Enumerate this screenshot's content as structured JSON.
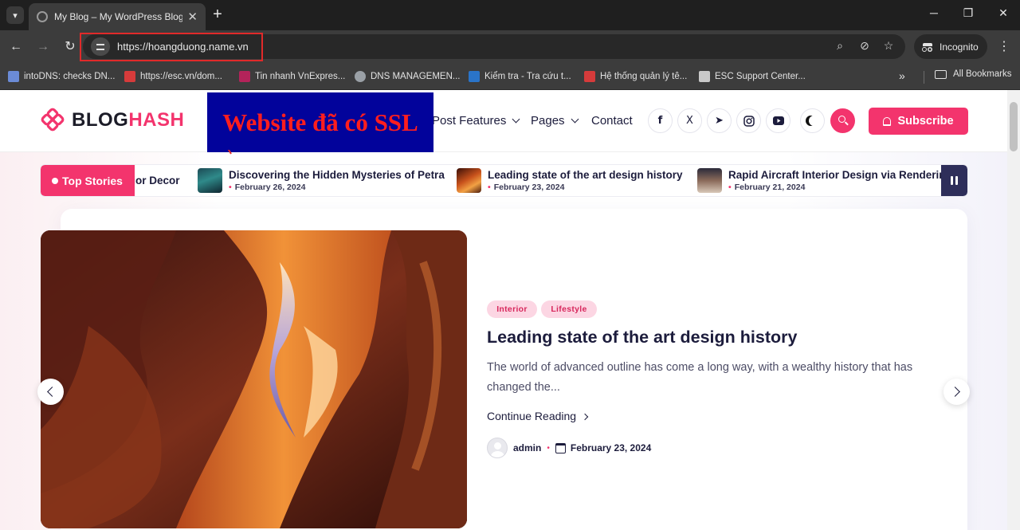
{
  "browser": {
    "tab_title": "My Blog – My WordPress Blog",
    "url": "https://hoangduong.name.vn",
    "incognito_label": "Incognito",
    "bookmarks": [
      {
        "label": "intoDNS: checks DN...",
        "icon": "dns-check-icon",
        "color": "#6b8bd6"
      },
      {
        "label": "https://esc.vn/dom...",
        "icon": "esc-favicon-icon",
        "color": "#d63b3b"
      },
      {
        "label": "Tin nhanh VnExpres...",
        "icon": "vnexpress-icon",
        "color": "#b4235a"
      },
      {
        "label": "DNS MANAGEMEN...",
        "icon": "globe-icon",
        "color": "#9aa0a6"
      },
      {
        "label": "Kiểm tra - Tra cứu t...",
        "icon": "inet-icon",
        "color": "#2a74c9"
      },
      {
        "label": "Hệ thống quản lý tê...",
        "icon": "esc-favicon-icon",
        "color": "#d63b3b"
      },
      {
        "label": "ESC Support Center...",
        "icon": "support-icon",
        "color": "#c9c9c9"
      }
    ],
    "all_bookmarks_label": "All Bookmarks"
  },
  "annotation": {
    "ssl_banner": "Website đã có SSL"
  },
  "site": {
    "logo_prefix": "BLOG",
    "logo_accent": "HASH",
    "nav": [
      "Post Features",
      "Pages",
      "Contact"
    ],
    "social": [
      {
        "icon": "facebook-icon",
        "glyph": "f"
      },
      {
        "icon": "x-twitter-icon",
        "glyph": "𝕏"
      },
      {
        "icon": "telegram-icon",
        "glyph": "➤"
      },
      {
        "icon": "instagram-icon",
        "glyph": "◎"
      },
      {
        "icon": "youtube-icon",
        "glyph": "▶"
      }
    ],
    "subscribe_label": "Subscribe",
    "accent_color": "#f3346d"
  },
  "ticker": {
    "label": "Top Stories",
    "items": [
      {
        "title": "rior Decor",
        "date": ""
      },
      {
        "title": "Discovering the Hidden Mysteries of Petra",
        "date": "February 26, 2024"
      },
      {
        "title": "Leading state of the art design history",
        "date": "February 23, 2024"
      },
      {
        "title": "Rapid Aircraft Interior Design via Renderin",
        "date": "February 21, 2024"
      }
    ]
  },
  "featured": {
    "categories": [
      "Interior",
      "Lifestyle"
    ],
    "title": "Leading state of the art design history",
    "excerpt": "The world of advanced outline has come a long way, with a wealthy history that has changed the...",
    "continue_label": "Continue Reading",
    "author": "admin",
    "date": "February 23, 2024"
  }
}
